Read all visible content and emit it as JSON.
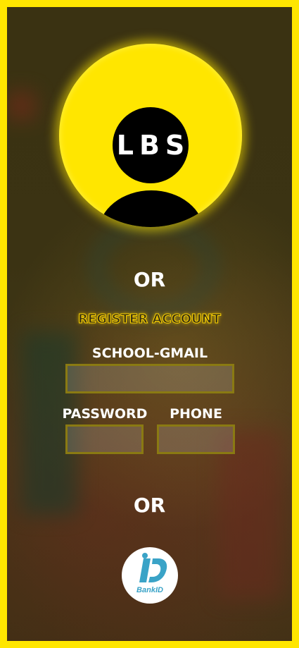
{
  "logo": {
    "text": "LBS"
  },
  "divider_top": "OR",
  "register": {
    "label": "REGISTER ACCOUNT"
  },
  "form": {
    "school_gmail_label": "SCHOOL-GMAIL",
    "school_gmail_value": "",
    "password_label": "PASSWORD",
    "password_value": "",
    "phone_label": "PHONE",
    "phone_value": ""
  },
  "divider_bottom": "OR",
  "bankid": {
    "label": "BankID"
  },
  "colors": {
    "accent": "#ffe600",
    "bankid_blue": "#3aa3c7"
  }
}
